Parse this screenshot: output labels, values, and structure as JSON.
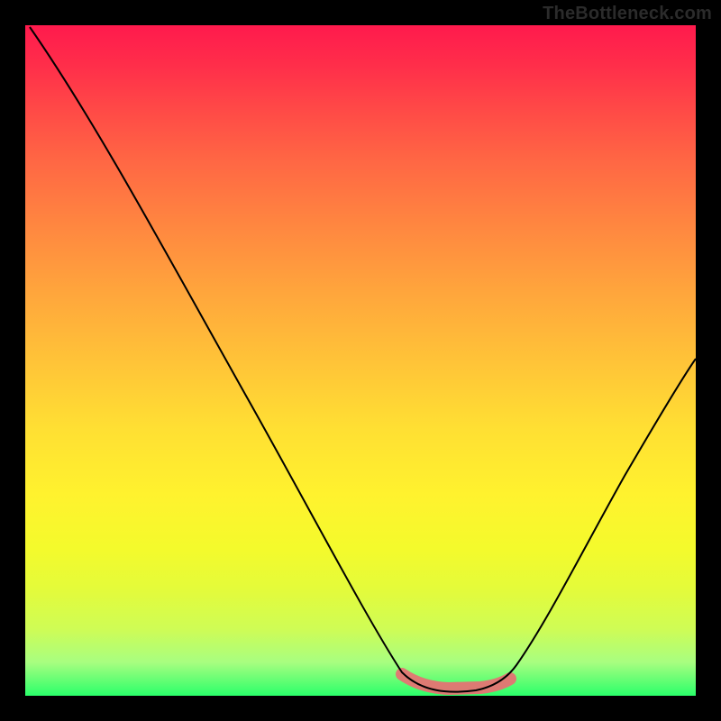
{
  "watermark": "TheBottleneck.com",
  "chart_data": {
    "type": "line",
    "title": "",
    "xlabel": "",
    "ylabel": "",
    "xlim": [
      0,
      100
    ],
    "ylim": [
      0,
      100
    ],
    "grid": false,
    "series": [
      {
        "name": "bottleneck-curve",
        "x": [
          0,
          5,
          10,
          15,
          20,
          25,
          30,
          35,
          40,
          45,
          50,
          55,
          58,
          60,
          62,
          65,
          68,
          70,
          75,
          80,
          85,
          90,
          95,
          100
        ],
        "y": [
          100,
          92,
          84,
          76,
          68,
          60,
          52,
          44,
          36,
          28,
          20,
          12,
          7,
          4,
          2,
          2,
          2,
          3,
          6,
          12,
          22,
          35,
          47,
          55
        ]
      },
      {
        "name": "optimal-range-highlight",
        "x": [
          56,
          60,
          65,
          70,
          72
        ],
        "y": [
          4,
          2,
          2,
          3,
          3
        ]
      }
    ],
    "background_gradient": {
      "top": "#ff1a4d",
      "bottom": "#2aff6a",
      "meaning": "high-to-low bottleneck severity"
    },
    "highlight_color": "#e57373"
  }
}
